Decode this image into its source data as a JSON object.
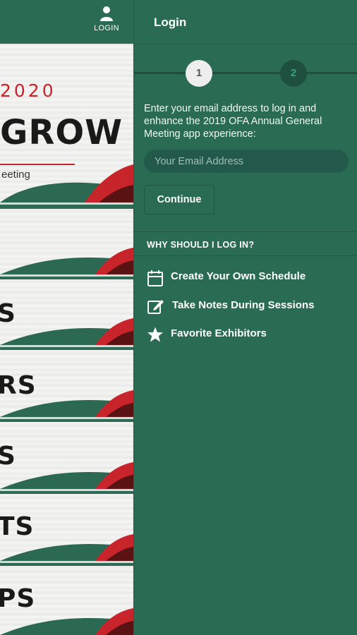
{
  "app_header": {
    "login_label": "LOGIN",
    "login_icon": "user-icon"
  },
  "banner": {
    "year": "2020",
    "headline": "GROW",
    "subtitle": "eeting"
  },
  "menu_tiles": [
    "",
    "S",
    "RS",
    "S",
    "TS",
    "PS"
  ],
  "drawer": {
    "title": "Login",
    "steps": [
      "1",
      "2"
    ],
    "intro": "Enter your email address to log in and enhance the 2019 OFA Annual General Meeting app experience:",
    "email_placeholder": "Your Email Address",
    "continue_label": "Continue",
    "why_heading": "WHY SHOULD I LOG IN?",
    "benefits": [
      {
        "icon": "calendar-icon",
        "label": "Create Your Own Schedule"
      },
      {
        "icon": "note-edit-icon",
        "label": "Take Notes During Sessions"
      },
      {
        "icon": "star-icon",
        "label": "Favorite Exhibitors"
      }
    ]
  },
  "colors": {
    "brand_green": "#2a6b54",
    "dark_green": "#1f4f3e",
    "accent_red": "#c8242b"
  }
}
